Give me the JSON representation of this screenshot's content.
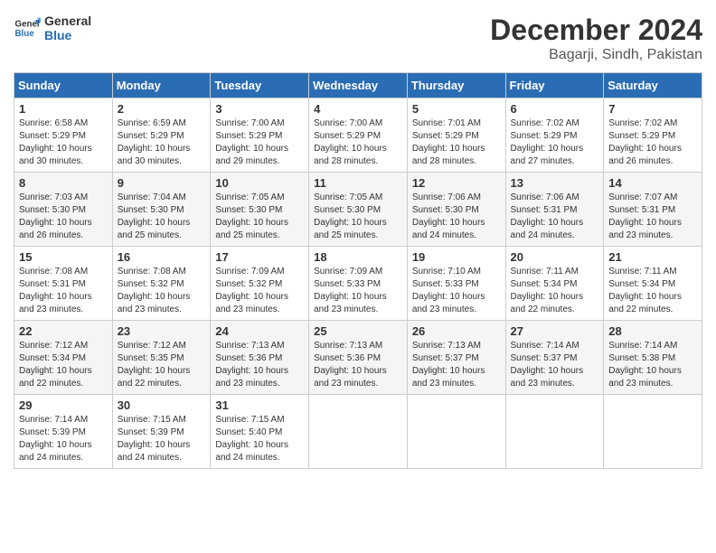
{
  "header": {
    "logo_line1": "General",
    "logo_line2": "Blue",
    "month_year": "December 2024",
    "location": "Bagarji, Sindh, Pakistan"
  },
  "weekdays": [
    "Sunday",
    "Monday",
    "Tuesday",
    "Wednesday",
    "Thursday",
    "Friday",
    "Saturday"
  ],
  "weeks": [
    [
      {
        "day": "1",
        "info": "Sunrise: 6:58 AM\nSunset: 5:29 PM\nDaylight: 10 hours\nand 30 minutes."
      },
      {
        "day": "2",
        "info": "Sunrise: 6:59 AM\nSunset: 5:29 PM\nDaylight: 10 hours\nand 30 minutes."
      },
      {
        "day": "3",
        "info": "Sunrise: 7:00 AM\nSunset: 5:29 PM\nDaylight: 10 hours\nand 29 minutes."
      },
      {
        "day": "4",
        "info": "Sunrise: 7:00 AM\nSunset: 5:29 PM\nDaylight: 10 hours\nand 28 minutes."
      },
      {
        "day": "5",
        "info": "Sunrise: 7:01 AM\nSunset: 5:29 PM\nDaylight: 10 hours\nand 28 minutes."
      },
      {
        "day": "6",
        "info": "Sunrise: 7:02 AM\nSunset: 5:29 PM\nDaylight: 10 hours\nand 27 minutes."
      },
      {
        "day": "7",
        "info": "Sunrise: 7:02 AM\nSunset: 5:29 PM\nDaylight: 10 hours\nand 26 minutes."
      }
    ],
    [
      {
        "day": "8",
        "info": "Sunrise: 7:03 AM\nSunset: 5:30 PM\nDaylight: 10 hours\nand 26 minutes."
      },
      {
        "day": "9",
        "info": "Sunrise: 7:04 AM\nSunset: 5:30 PM\nDaylight: 10 hours\nand 25 minutes."
      },
      {
        "day": "10",
        "info": "Sunrise: 7:05 AM\nSunset: 5:30 PM\nDaylight: 10 hours\nand 25 minutes."
      },
      {
        "day": "11",
        "info": "Sunrise: 7:05 AM\nSunset: 5:30 PM\nDaylight: 10 hours\nand 25 minutes."
      },
      {
        "day": "12",
        "info": "Sunrise: 7:06 AM\nSunset: 5:30 PM\nDaylight: 10 hours\nand 24 minutes."
      },
      {
        "day": "13",
        "info": "Sunrise: 7:06 AM\nSunset: 5:31 PM\nDaylight: 10 hours\nand 24 minutes."
      },
      {
        "day": "14",
        "info": "Sunrise: 7:07 AM\nSunset: 5:31 PM\nDaylight: 10 hours\nand 23 minutes."
      }
    ],
    [
      {
        "day": "15",
        "info": "Sunrise: 7:08 AM\nSunset: 5:31 PM\nDaylight: 10 hours\nand 23 minutes."
      },
      {
        "day": "16",
        "info": "Sunrise: 7:08 AM\nSunset: 5:32 PM\nDaylight: 10 hours\nand 23 minutes."
      },
      {
        "day": "17",
        "info": "Sunrise: 7:09 AM\nSunset: 5:32 PM\nDaylight: 10 hours\nand 23 minutes."
      },
      {
        "day": "18",
        "info": "Sunrise: 7:09 AM\nSunset: 5:33 PM\nDaylight: 10 hours\nand 23 minutes."
      },
      {
        "day": "19",
        "info": "Sunrise: 7:10 AM\nSunset: 5:33 PM\nDaylight: 10 hours\nand 23 minutes."
      },
      {
        "day": "20",
        "info": "Sunrise: 7:11 AM\nSunset: 5:34 PM\nDaylight: 10 hours\nand 22 minutes."
      },
      {
        "day": "21",
        "info": "Sunrise: 7:11 AM\nSunset: 5:34 PM\nDaylight: 10 hours\nand 22 minutes."
      }
    ],
    [
      {
        "day": "22",
        "info": "Sunrise: 7:12 AM\nSunset: 5:34 PM\nDaylight: 10 hours\nand 22 minutes."
      },
      {
        "day": "23",
        "info": "Sunrise: 7:12 AM\nSunset: 5:35 PM\nDaylight: 10 hours\nand 22 minutes."
      },
      {
        "day": "24",
        "info": "Sunrise: 7:13 AM\nSunset: 5:36 PM\nDaylight: 10 hours\nand 23 minutes."
      },
      {
        "day": "25",
        "info": "Sunrise: 7:13 AM\nSunset: 5:36 PM\nDaylight: 10 hours\nand 23 minutes."
      },
      {
        "day": "26",
        "info": "Sunrise: 7:13 AM\nSunset: 5:37 PM\nDaylight: 10 hours\nand 23 minutes."
      },
      {
        "day": "27",
        "info": "Sunrise: 7:14 AM\nSunset: 5:37 PM\nDaylight: 10 hours\nand 23 minutes."
      },
      {
        "day": "28",
        "info": "Sunrise: 7:14 AM\nSunset: 5:38 PM\nDaylight: 10 hours\nand 23 minutes."
      }
    ],
    [
      {
        "day": "29",
        "info": "Sunrise: 7:14 AM\nSunset: 5:39 PM\nDaylight: 10 hours\nand 24 minutes."
      },
      {
        "day": "30",
        "info": "Sunrise: 7:15 AM\nSunset: 5:39 PM\nDaylight: 10 hours\nand 24 minutes."
      },
      {
        "day": "31",
        "info": "Sunrise: 7:15 AM\nSunset: 5:40 PM\nDaylight: 10 hours\nand 24 minutes."
      },
      {
        "day": "",
        "info": ""
      },
      {
        "day": "",
        "info": ""
      },
      {
        "day": "",
        "info": ""
      },
      {
        "day": "",
        "info": ""
      }
    ]
  ]
}
